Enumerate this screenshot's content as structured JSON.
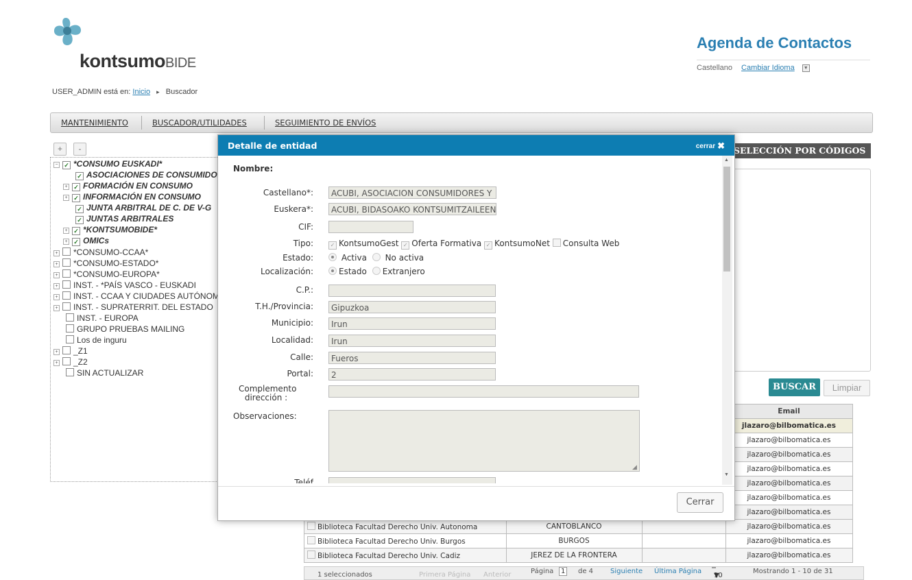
{
  "header": {
    "logo_main": "kontsumo",
    "logo_suffix": "BIDE",
    "app_title": "Agenda de Contactos",
    "language": "Castellano",
    "change_language": "Cambiar Idioma"
  },
  "breadcrumb": {
    "prefix": "USER_ADMIN está en:",
    "home": "Inicio",
    "current": "Buscador"
  },
  "menu": {
    "items": [
      "MANTENIMIENTO",
      "BUSCADOR/UTILIDADES",
      "SEGUIMIENTO DE ENVÍOS"
    ]
  },
  "tree": {
    "expand": "+",
    "collapse": "-",
    "nodes": [
      {
        "label": "*CONSUMO EUSKADI*",
        "checked": true
      },
      {
        "label": "ASOCIACIONES DE CONSUMIDORES",
        "checked": true
      },
      {
        "label": "FORMACIÓN EN CONSUMO",
        "checked": true
      },
      {
        "label": "INFORMACIÓN EN CONSUMO",
        "checked": true
      },
      {
        "label": "JUNTA ARBITRAL DE C. DE V-G",
        "checked": true
      },
      {
        "label": "JUNTAS ARBITRALES",
        "checked": true
      },
      {
        "label": "*KONTSUMOBIDE*",
        "checked": true
      },
      {
        "label": "OMICs",
        "checked": true
      },
      {
        "label": "*CONSUMO-CCAA*",
        "checked": false
      },
      {
        "label": "*CONSUMO-ESTADO*",
        "checked": false
      },
      {
        "label": "*CONSUMO-EUROPA*",
        "checked": false
      },
      {
        "label": "INST. - *PAÍS VASCO - EUSKADI",
        "checked": false
      },
      {
        "label": "INST. - CCAA Y CIUDADES AUTÓNOMAS",
        "checked": false
      },
      {
        "label": "INST. - SUPRATERRIT. DEL ESTADO",
        "checked": false
      },
      {
        "label": "INST. - EUROPA",
        "checked": false
      },
      {
        "label": "GRUPO PRUEBAS MAILING",
        "checked": false
      },
      {
        "label": "Los de inguru",
        "checked": false
      },
      {
        "label": "_Z1",
        "checked": false
      },
      {
        "label": "_Z2",
        "checked": false
      },
      {
        "label": "SIN ACTUALIZAR",
        "checked": false
      }
    ]
  },
  "right_panel": {
    "seleccion_tab": "SELECCIÓN POR CÓDIGOS",
    "buscar": "BUSCAR",
    "limpiar": "Limpiar"
  },
  "results": {
    "email_header": "Email",
    "emails": [
      "jlazaro@bilbomatica.es",
      "jlazaro@bilbomatica.es",
      "jlazaro@bilbomatica.es",
      "jlazaro@bilbomatica.es",
      "jlazaro@bilbomatica.es",
      "jlazaro@bilbomatica.es",
      "jlazaro@bilbomatica.es"
    ],
    "rows": [
      {
        "name": "Biblioteca Facultad Derecho Univ. Autonoma",
        "city": "CANTOBLANCO",
        "email": "jlazaro@bilbomatica.es"
      },
      {
        "name": "Biblioteca Facultad Derecho Univ. Burgos",
        "city": "BURGOS",
        "email": "jlazaro@bilbomatica.es"
      },
      {
        "name": "Biblioteca Facultad Derecho Univ. Cadiz",
        "city": "JEREZ DE LA FRONTERA",
        "email": "jlazaro@bilbomatica.es"
      }
    ],
    "pager": {
      "selected": "1 seleccionados",
      "first": "Primera Página",
      "prev": "Anterior",
      "page_label": "Página",
      "page_value": "1",
      "of": "de 4",
      "next": "Siguiente",
      "last": "Última Página",
      "page_size": "10",
      "showing": "Mostrando 1 - 10 de 31"
    }
  },
  "modal": {
    "title": "Detalle de entidad",
    "close_link": "cerrar",
    "section": "Nombre:",
    "labels": {
      "castellano": "Castellano*:",
      "euskera": "Euskera*:",
      "cif": "CIF:",
      "tipo": "Tipo:",
      "estado": "Estado:",
      "localizacion": "Localización:",
      "cp": "C.P.:",
      "provincia": "T.H./Provincia:",
      "municipio": "Municipio:",
      "localidad": "Localidad:",
      "calle": "Calle:",
      "portal": "Portal:",
      "complemento": "Complemento dirección :",
      "observaciones": "Observaciones:",
      "telefono": "Teléf"
    },
    "values": {
      "castellano": "ACUBI, ASOCIACION CONSUMIDORES Y",
      "euskera": "ACUBI, BIDASOAKO KONTSUMITZAILEEN",
      "cif": "",
      "cp": "",
      "provincia": "Gipuzkoa",
      "municipio": "Irun",
      "localidad": "Irun",
      "calle": "Fueros",
      "portal": "2",
      "complemento": "",
      "observaciones": ""
    },
    "tipo_options": [
      "KontsumoGest",
      "Oferta Formativa",
      "KontsumoNet",
      "Consulta Web"
    ],
    "estado_options": [
      "Activa",
      "No activa"
    ],
    "localizacion_options": [
      "Estado",
      "Extranjero"
    ],
    "cerrar_button": "Cerrar"
  }
}
